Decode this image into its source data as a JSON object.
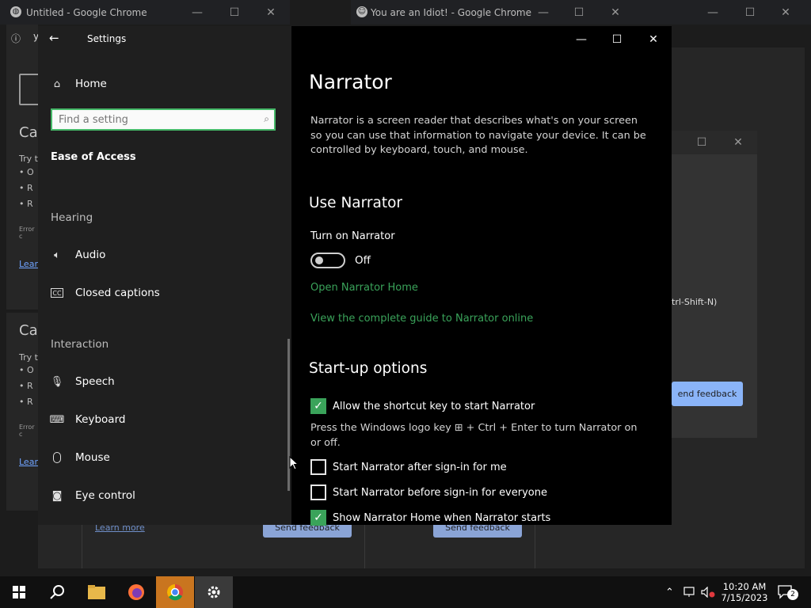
{
  "bg_windows": {
    "left": {
      "title": "Untitled - Google Chrome",
      "favicon": "globe-icon",
      "addr_label": "y",
      "heading1": "Ca",
      "heading2": "Ca",
      "small1": "Try t",
      "small2": "Try t",
      "error": "Error c",
      "error2": "Error c",
      "link": "Lear",
      "link2": "Lear",
      "bullets": [
        "O",
        "R",
        "R"
      ]
    },
    "right": {
      "title": "You are an Idiot! - Google Chrome",
      "favicon": "smiley-icon",
      "shortcut_text": "trl-Shift-N)",
      "feedback_btn": "end feedback",
      "learn_more": "Learn more",
      "send_feedback": "Send feedback"
    },
    "controls": {
      "minimize": "—",
      "maximize": "☐",
      "close": "✕"
    }
  },
  "settings": {
    "header": {
      "title": "Settings",
      "back_icon": "back-arrow-icon"
    },
    "nav_home": "Home",
    "search": {
      "placeholder": "Find a setting"
    },
    "category": "Ease of Access",
    "sections": [
      {
        "title": "Hearing",
        "items": [
          {
            "label": "Audio",
            "icon": "speaker-icon"
          },
          {
            "label": "Closed captions",
            "icon": "cc-icon"
          }
        ]
      },
      {
        "title": "Interaction",
        "items": [
          {
            "label": "Speech",
            "icon": "microphone-icon"
          },
          {
            "label": "Keyboard",
            "icon": "keyboard-icon"
          },
          {
            "label": "Mouse",
            "icon": "mouse-icon"
          },
          {
            "label": "Eye control",
            "icon": "eye-control-icon"
          }
        ]
      }
    ]
  },
  "narrator": {
    "title": "Narrator",
    "description": "Narrator is a screen reader that describes what's on your screen so you can use that information to navigate your device. It can be controlled by keyboard, touch, and mouse.",
    "use_heading": "Use Narrator",
    "toggle_label": "Turn on Narrator",
    "toggle_state": "Off",
    "link_home": "Open Narrator Home",
    "link_guide": "View the complete guide to Narrator online",
    "startup_heading": "Start-up options",
    "option1": "Allow the shortcut key to start Narrator",
    "shortcut_help": "Press the Windows logo key ⊞ + Ctrl + Enter to turn Narrator on or off.",
    "option2": "Start Narrator after sign-in for me",
    "option3": "Start Narrator before sign-in for everyone",
    "option4": "Show Narrator Home when Narrator starts",
    "checked": [
      true,
      false,
      false,
      true
    ],
    "window_controls": {
      "minimize": "—",
      "maximize": "☐",
      "close": "✕"
    }
  },
  "taskbar": {
    "apps": [
      "windows-start-icon",
      "search-icon",
      "file-explorer-icon",
      "firefox-icon",
      "chrome-icon",
      "settings-icon"
    ],
    "time": "10:20 AM",
    "date": "7/15/2023",
    "notification_count": "2"
  },
  "colors": {
    "accent": "#3aa35a",
    "taskbar_active": "#c9751f"
  }
}
